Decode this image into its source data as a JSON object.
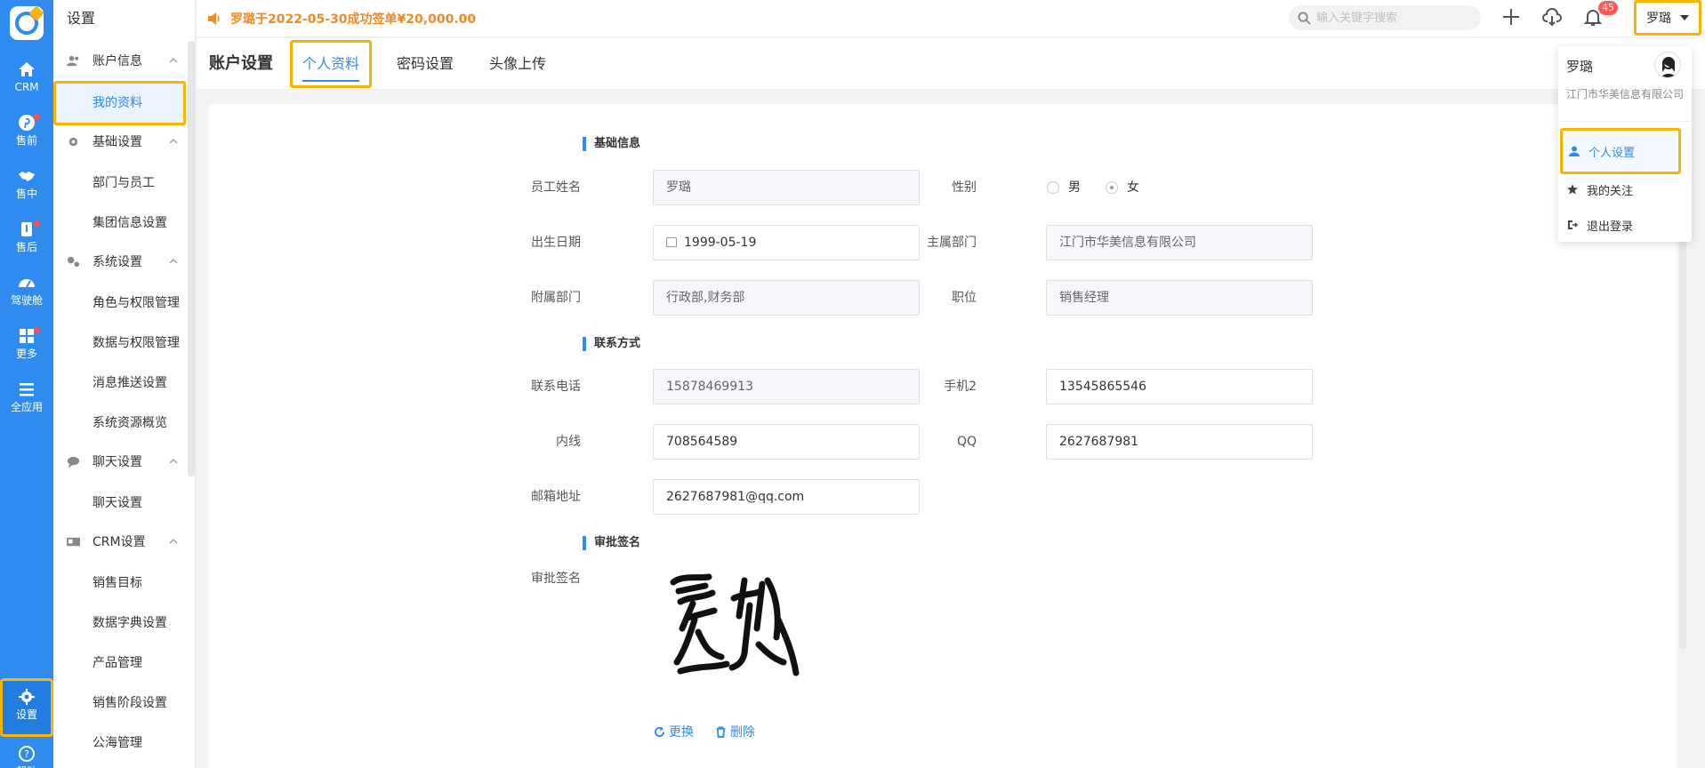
{
  "rail": {
    "items": [
      {
        "label": "CRM",
        "icon": "home-icon",
        "dot": false
      },
      {
        "label": "售前",
        "icon": "pinterest-icon",
        "dot": true
      },
      {
        "label": "售中",
        "icon": "handshake-icon",
        "dot": false
      },
      {
        "label": "售后",
        "icon": "wrench-icon",
        "dot": true
      },
      {
        "label": "驾驶舱",
        "icon": "dashboard-icon",
        "dot": false
      },
      {
        "label": "更多",
        "icon": "grid-icon",
        "dot": true
      },
      {
        "label": "全应用",
        "icon": "menu-icon",
        "dot": false
      },
      {
        "label": "设置",
        "icon": "gear-icon",
        "dot": false
      },
      {
        "label": "帮助",
        "icon": "help-icon",
        "dot": false
      }
    ]
  },
  "nav": {
    "title": "设置",
    "groups": [
      {
        "label": "账户信息",
        "icon": "users-icon",
        "items": [
          "我的资料"
        ]
      },
      {
        "label": "基础设置",
        "icon": "gear-icon",
        "items": [
          "部门与员工",
          "集团信息设置"
        ]
      },
      {
        "label": "系统设置",
        "icon": "gears-icon",
        "items": [
          "角色与权限管理",
          "数据与权限管理",
          "消息推送设置",
          "系统资源概览"
        ]
      },
      {
        "label": "聊天设置",
        "icon": "chat-icon",
        "items": [
          "聊天设置"
        ]
      },
      {
        "label": "CRM设置",
        "icon": "idcard-icon",
        "items": [
          "销售目标",
          "数据字典设置",
          "产品管理",
          "销售阶段设置",
          "公海管理"
        ]
      }
    ]
  },
  "topbar": {
    "notice": "罗璐于2022-05-30成功签单¥20,000.00",
    "search_placeholder": "输入关键字搜索",
    "badge": "45",
    "user": "罗璐"
  },
  "subheader": {
    "title": "账户设置",
    "tabs": [
      "个人资料",
      "密码设置",
      "头像上传"
    ]
  },
  "form": {
    "basic_title": "基础信息",
    "contact_title": "联系方式",
    "sign_title": "审批签名",
    "labels": {
      "name": "员工姓名",
      "gender": "性别",
      "birth": "出生日期",
      "main_dept": "主属部门",
      "sub_dept": "附属部门",
      "position": "职位",
      "phone": "联系电话",
      "mobile2": "手机2",
      "ext": "内线",
      "qq": "QQ",
      "email": "邮箱地址",
      "signature": "审批签名"
    },
    "values": {
      "name": "罗璐",
      "gender_male": "男",
      "gender_female": "女",
      "birth": "1999-05-19",
      "main_dept": "江门市华美信息有限公司",
      "sub_dept": "行政部,财务部",
      "position": "销售经理",
      "phone": "15878469913",
      "mobile2": "13545865546",
      "ext": "708564589",
      "qq": "2627687981",
      "email": "2627687981@qq.com"
    },
    "actions": {
      "replace": "更换",
      "delete": "删除"
    }
  },
  "dropdown": {
    "name": "罗璐",
    "company": "江门市华美信息有限公司",
    "items": [
      "个人设置",
      "我的关注",
      "退出登录"
    ]
  }
}
